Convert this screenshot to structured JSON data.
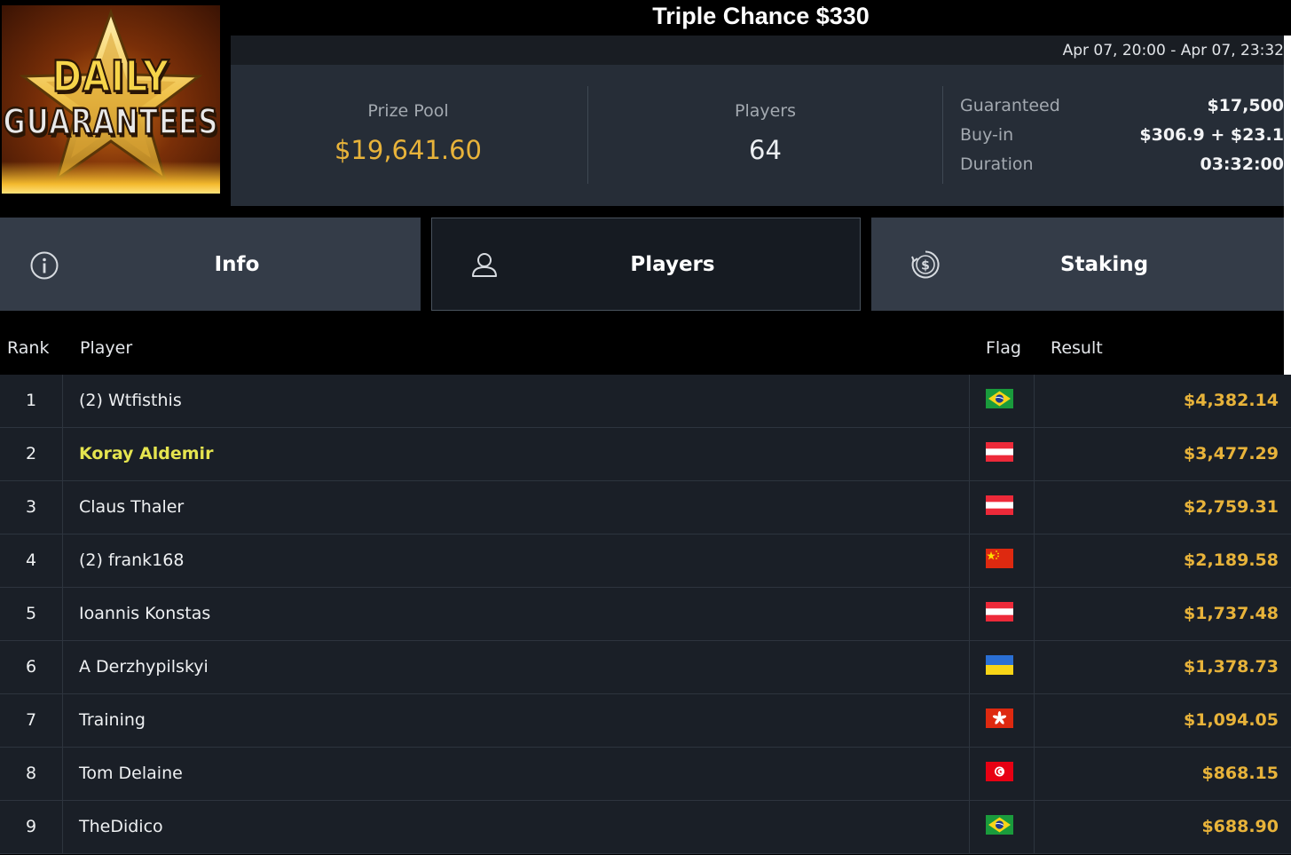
{
  "tournament": {
    "title": "Triple Chance $330",
    "date_range": "Apr 07, 20:00 - Apr 07, 23:32",
    "logo": {
      "line1": "DAILY",
      "line2": "GUARANTEES"
    }
  },
  "stats": {
    "prize_pool_label": "Prize Pool",
    "prize_pool_value": "$19,641.60",
    "players_label": "Players",
    "players_value": "64",
    "guaranteed_label": "Guaranteed",
    "guaranteed_value": "$17,500",
    "buyin_label": "Buy-in",
    "buyin_value": "$306.9 + $23.1",
    "duration_label": "Duration",
    "duration_value": "03:32:00"
  },
  "tabs": [
    {
      "label": "Info",
      "icon": "info-icon",
      "active": false
    },
    {
      "label": "Players",
      "icon": "user-icon",
      "active": true
    },
    {
      "label": "Staking",
      "icon": "dollar-coin-icon",
      "active": false
    }
  ],
  "table": {
    "headers": {
      "rank": "Rank",
      "player": "Player",
      "flag": "Flag",
      "result": "Result"
    },
    "rows": [
      {
        "rank": "1",
        "player": "(2) Wtfisthis",
        "flag": "brazil",
        "result": "$4,382.14",
        "highlight": false
      },
      {
        "rank": "2",
        "player": "Koray Aldemir",
        "flag": "austria",
        "result": "$3,477.29",
        "highlight": true
      },
      {
        "rank": "3",
        "player": "Claus Thaler",
        "flag": "austria",
        "result": "$2,759.31",
        "highlight": false
      },
      {
        "rank": "4",
        "player": "(2) frank168",
        "flag": "china",
        "result": "$2,189.58",
        "highlight": false
      },
      {
        "rank": "5",
        "player": "Ioannis Konstas",
        "flag": "austria",
        "result": "$1,737.48",
        "highlight": false
      },
      {
        "rank": "6",
        "player": "A Derzhypilskyi",
        "flag": "ukraine",
        "result": "$1,378.73",
        "highlight": false
      },
      {
        "rank": "7",
        "player": "Training",
        "flag": "hong-kong",
        "result": "$1,094.05",
        "highlight": false
      },
      {
        "rank": "8",
        "player": "Tom Delaine",
        "flag": "tunisia",
        "result": "$868.15",
        "highlight": false
      },
      {
        "rank": "9",
        "player": "TheDidico",
        "flag": "brazil",
        "result": "$688.90",
        "highlight": false
      }
    ]
  },
  "colors": {
    "gold": "#e8b33a",
    "highlight_player": "#e5e44f",
    "panel": "#262d37",
    "row_bg": "#1a1f27"
  }
}
